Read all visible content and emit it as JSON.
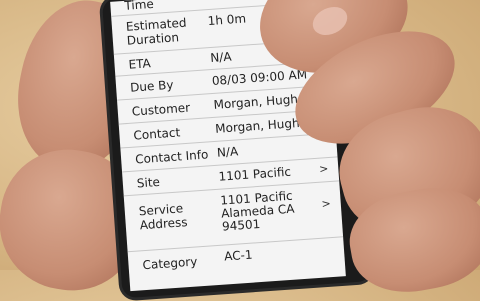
{
  "screen": {
    "rows": [
      {
        "label": "Time",
        "value": "",
        "chevron": ""
      },
      {
        "label": "Estimated Duration",
        "value": "1h 0m",
        "chevron": ""
      },
      {
        "label": "ETA",
        "value": "N/A",
        "chevron": ">"
      },
      {
        "label": "Due By",
        "value": "08/03 09:00 AM",
        "chevron": ""
      },
      {
        "label": "Customer",
        "value": "Morgan, Hugh",
        "chevron": ""
      },
      {
        "label": "Contact",
        "value": "Morgan, Hugh",
        "chevron": ""
      },
      {
        "label": "Contact Info",
        "value": "N/A",
        "chevron": ""
      },
      {
        "label": "Site",
        "value": "1101 Pacific",
        "chevron": ">"
      },
      {
        "label": "Service Address",
        "value": "1101 Pacific Alameda CA 94501",
        "chevron": ">"
      },
      {
        "label": "Category",
        "value": "AC-1",
        "chevron": ""
      }
    ]
  }
}
